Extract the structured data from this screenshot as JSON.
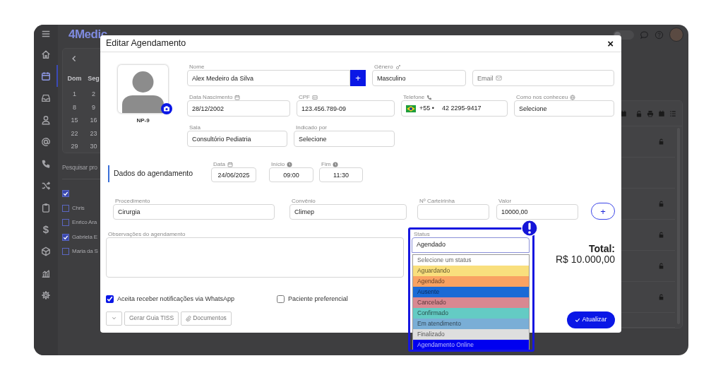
{
  "app": {
    "logo": "4Medic",
    "theme_toggle": {
      "on": false
    }
  },
  "sidebar": {
    "items": [
      {
        "selected": false
      },
      {
        "selected": true
      },
      {
        "selected": false
      },
      {
        "selected": false
      },
      {
        "selected": false
      },
      {
        "selected": false
      },
      {
        "selected": false
      },
      {
        "selected": false
      },
      {
        "glyph": "$",
        "selected": false
      },
      {
        "selected": false
      },
      {
        "selected": false
      },
      {
        "selected": false
      }
    ]
  },
  "calendar": {
    "weekdays": [
      "Dom",
      "Seg"
    ],
    "weeks": [
      [
        "1",
        "2"
      ],
      [
        "8",
        "9"
      ],
      [
        "15",
        "16"
      ],
      [
        "22",
        "23"
      ],
      [
        "29",
        "30"
      ]
    ]
  },
  "search": {
    "placeholder": "Pesquisar pro"
  },
  "professionals": [
    {
      "checked": true
    },
    {
      "label": "Chris",
      "checked": false
    },
    {
      "label": "Enrico Ara",
      "checked": false
    },
    {
      "label": "Gabriela E",
      "checked": true
    },
    {
      "label": "Maria da S",
      "checked": false
    }
  ],
  "schedule_table": {
    "rows": [
      {
        "locked": true
      },
      {
        "locked": false
      },
      {
        "locked": true
      },
      {
        "locked": true
      },
      {
        "locked": true
      },
      {
        "locked": true
      },
      {
        "locked": false
      }
    ]
  },
  "modal": {
    "title": "Editar Agendamento",
    "close_label": "×",
    "photo_caption": "NP-9",
    "patient_rows": [
      [
        {
          "kind": "add",
          "label": "Nome",
          "value": "Alex Medeiro da Silva",
          "button_label": "+"
        },
        {
          "kind": "select",
          "label": "Gênero",
          "value": "Masculino"
        },
        {
          "kind": "email",
          "placeholder": "Email"
        }
      ],
      [
        {
          "kind": "text",
          "label": "Data Nascimento",
          "value": "28/12/2002"
        },
        {
          "kind": "text",
          "label": "CPF",
          "value": "123.456.789-09"
        },
        {
          "kind": "phone",
          "label": "Telefone",
          "country_code": "+55 •",
          "value": "42 2295-9417"
        },
        {
          "kind": "select",
          "label": "Como nos conheceu",
          "value": "Selecione"
        }
      ],
      [
        {
          "kind": "select",
          "label": "Sala",
          "value": "Consultório Pediatria"
        },
        {
          "kind": "select",
          "label": "Indicado por",
          "value": "Selecione"
        }
      ]
    ],
    "section_title": "Dados do agendamento",
    "time_fields": [
      {
        "label": "Data",
        "value": "24/06/2025"
      },
      {
        "label": "Início",
        "value": "09:00"
      },
      {
        "label": "Fim",
        "value": "11:30"
      }
    ],
    "billing_fields": [
      {
        "label": "Procedimento",
        "value": "Cirurgia"
      },
      {
        "label": "Convênio",
        "value": "Climep"
      },
      {
        "label": "Nº Carteirinha"
      },
      {
        "label": "Valor",
        "value": "10000,00"
      }
    ],
    "add_button": "+",
    "notes": {
      "label": "Observações do agendamento"
    },
    "status": {
      "label": "Status",
      "value": "Agendado",
      "expanded": true,
      "options": [
        {
          "label": "Selecione um status",
          "color": "#ffffff"
        },
        {
          "label": "Aguardando",
          "color": "#f9df7d"
        },
        {
          "label": "Agendado",
          "color": "#f9a262"
        },
        {
          "label": "Ausente",
          "color": "#1a6ad6"
        },
        {
          "label": "Cancelado",
          "color": "#d98891"
        },
        {
          "label": "Confirmado",
          "color": "#64cbc4"
        },
        {
          "label": "Em atendimento",
          "color": "#7aaed6"
        },
        {
          "label": "Finalizado",
          "color": "#dedede"
        },
        {
          "label": "Agendamento Online",
          "color": "#0000f0"
        }
      ]
    },
    "total": {
      "label": "Total:",
      "value": "R$ 10.000,00"
    },
    "checkboxes": [
      {
        "label": "Aceita receber notificações via WhatsApp",
        "checked": true
      },
      {
        "label": "Paciente preferencial",
        "checked": false
      }
    ],
    "actions": [
      {
        "kind": "menu"
      },
      {
        "kind": "plain",
        "label": "Gerar Guia TISS"
      },
      {
        "kind": "attach",
        "label": "Documentos"
      }
    ],
    "submit": "Atualizar"
  }
}
